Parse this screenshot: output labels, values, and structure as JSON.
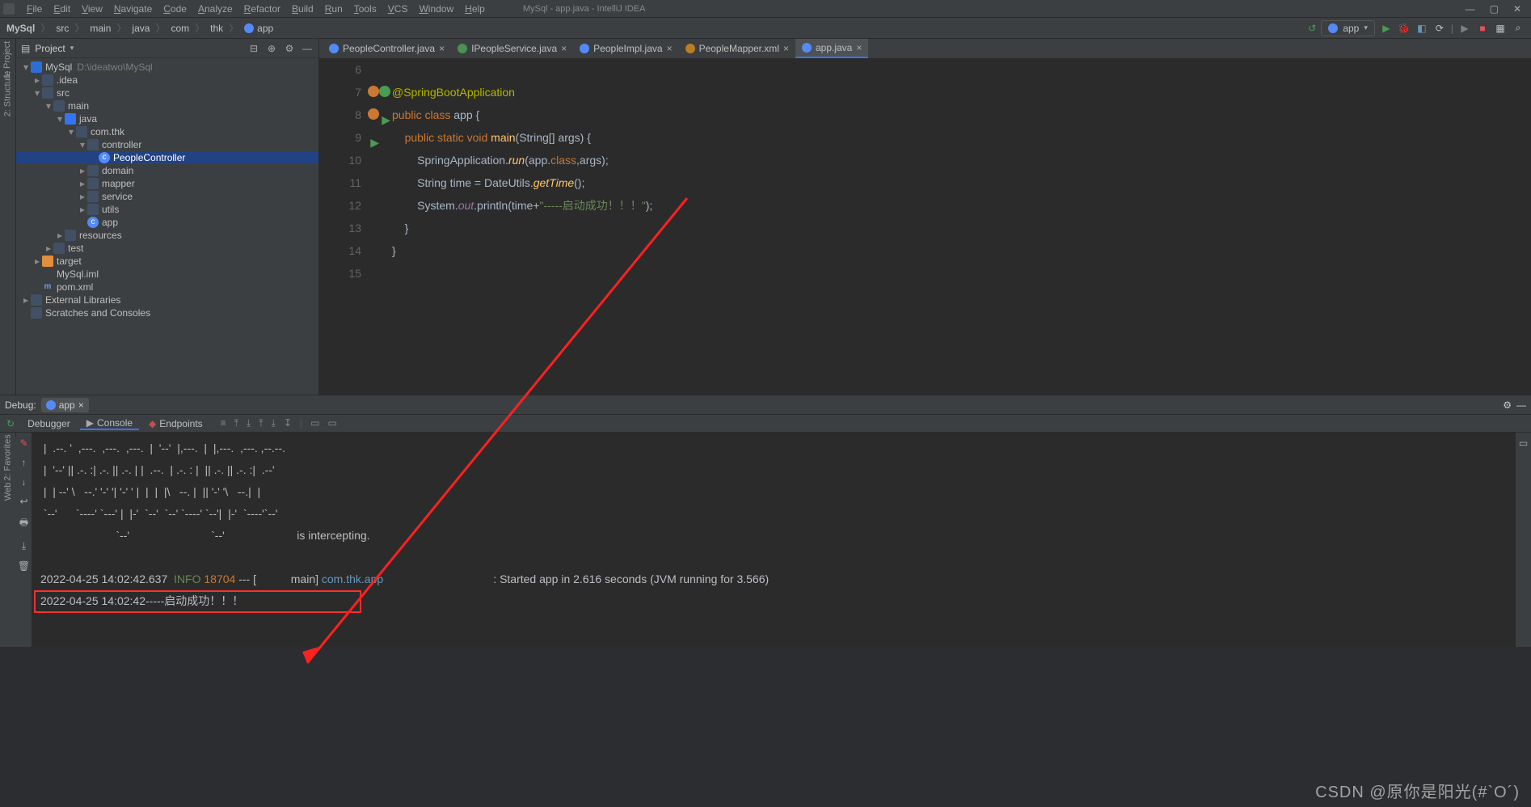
{
  "window": {
    "title": "MySql - app.java - IntelliJ IDEA"
  },
  "menu": [
    "File",
    "Edit",
    "View",
    "Navigate",
    "Code",
    "Analyze",
    "Refactor",
    "Build",
    "Run",
    "Tools",
    "VCS",
    "Window",
    "Help"
  ],
  "breadcrumb": [
    "MySql",
    "src",
    "main",
    "java",
    "com",
    "thk",
    "app"
  ],
  "runConfig": "app",
  "projectPanel": {
    "title": "Project",
    "root": "MySql",
    "rootPath": "D:\\ideatwo\\MySql"
  },
  "tree": [
    {
      "d": 0,
      "exp": "▾",
      "ic": "module",
      "label": "MySql",
      "dim": "D:\\ideatwo\\MySql"
    },
    {
      "d": 1,
      "exp": "▸",
      "ic": "dir",
      "label": ".idea"
    },
    {
      "d": 1,
      "exp": "▾",
      "ic": "dir",
      "label": "src"
    },
    {
      "d": 2,
      "exp": "▾",
      "ic": "dir",
      "label": "main"
    },
    {
      "d": 3,
      "exp": "▾",
      "ic": "blue",
      "label": "java"
    },
    {
      "d": 4,
      "exp": "▾",
      "ic": "dir",
      "label": "com.thk"
    },
    {
      "d": 5,
      "exp": "▾",
      "ic": "dir",
      "label": "controller"
    },
    {
      "d": 6,
      "exp": "",
      "ic": "class",
      "label": "PeopleController",
      "selected": true
    },
    {
      "d": 5,
      "exp": "▸",
      "ic": "dir",
      "label": "domain"
    },
    {
      "d": 5,
      "exp": "▸",
      "ic": "dir",
      "label": "mapper"
    },
    {
      "d": 5,
      "exp": "▸",
      "ic": "dir",
      "label": "service"
    },
    {
      "d": 5,
      "exp": "▸",
      "ic": "dir",
      "label": "utils"
    },
    {
      "d": 5,
      "exp": "",
      "ic": "class",
      "label": "app"
    },
    {
      "d": 3,
      "exp": "▸",
      "ic": "dir",
      "label": "resources"
    },
    {
      "d": 2,
      "exp": "▸",
      "ic": "dir",
      "label": "test"
    },
    {
      "d": 1,
      "exp": "▸",
      "ic": "orange",
      "label": "target"
    },
    {
      "d": 1,
      "exp": "",
      "ic": "xml",
      "label": "MySql.iml"
    },
    {
      "d": 1,
      "exp": "",
      "ic": "m",
      "label": "pom.xml"
    },
    {
      "d": 0,
      "exp": "▸",
      "ic": "dir",
      "label": "External Libraries"
    },
    {
      "d": 0,
      "exp": "",
      "ic": "dir",
      "label": "Scratches and Consoles"
    }
  ],
  "editorTabs": [
    {
      "ic": "tc-jav",
      "label": "PeopleController.java"
    },
    {
      "ic": "tc-int",
      "label": "IPeopleService.java"
    },
    {
      "ic": "tc-jav",
      "label": "PeopleImpl.java"
    },
    {
      "ic": "tc-xml",
      "label": "PeopleMapper.xml"
    },
    {
      "ic": "tc-jav",
      "label": "app.java",
      "active": true
    }
  ],
  "code": {
    "lines": [
      6,
      7,
      8,
      9,
      10,
      11,
      12,
      13,
      14,
      15
    ],
    "l7": "@SpringBootApplication",
    "l8_a": "public class ",
    "l8_b": "app",
    "l8_c": " {",
    "l9_a": "public static void ",
    "l9_b": "main",
    "l9_c": "(String[] args) {",
    "l10_a": "SpringApplication.",
    "l10_b": "run",
    "l10_c": "(app.",
    "l10_d": "class",
    "l10_e": ",args);",
    "l11_a": "String time = DateUtils.",
    "l11_b": "getTime",
    "l11_c": "();",
    "l12_a": "System.",
    "l12_b": "out",
    "l12_c": ".println(time+",
    "l12_d": "\"-----启动成功！！！\"",
    "l12_e": ");",
    "l13": "}",
    "l14": "}"
  },
  "debug": {
    "title": "Debug:",
    "runName": "app",
    "tabs": [
      "Debugger",
      "Console",
      "Endpoints"
    ]
  },
  "console": {
    "ascii1": " |  .--. '  ,---.  ,---.  ,---.  |  '--'  |,---.  |  |,---.  ,---. ,--.--.",
    "ascii2": " |  '--' || .-. :| .-. || .-. | |  .--.  | .-. : |  || .-. || .-. :|  .--'",
    "ascii3": " |  | --' \\   --.' '-' '| '-' ' |  |  |  |\\   --. |  || '-' '\\   --.|  |",
    "ascii4": " `--'      `----' `---' |  |-'  `--'  `--' `----' `--'|  |-'  `----'`--'",
    "ascii5": "                        `--'                          `--'                       is intercepting.",
    "logTime": "2022-04-25 14:02:42.637",
    "logLevel": "INFO",
    "logPid": "18704",
    "logThread": " --- [           main] ",
    "logClass": "com.thk.app",
    "logMsg": ": Started app in 2.616 seconds (JVM running for 3.566)",
    "outLine": "2022-04-25 14:02:42-----启动成功！！！"
  },
  "watermark": "CSDN @原你是阳光(#`O´)"
}
